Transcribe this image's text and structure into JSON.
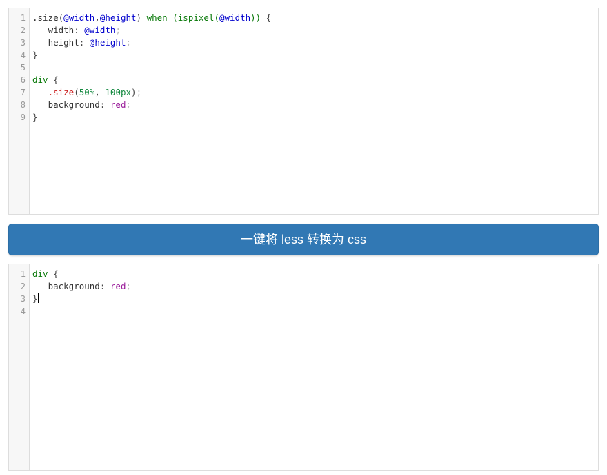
{
  "input_editor": {
    "name": "less-input-editor",
    "line_numbers": [
      "1",
      "2",
      "3",
      "4",
      "5",
      "6",
      "7",
      "8",
      "9"
    ],
    "lines": [
      {
        "n": "1",
        "tokens": [
          {
            "t": ".size",
            "c": "t-plain"
          },
          {
            "t": "(",
            "c": "t-punct"
          },
          {
            "t": "@width",
            "c": "t-var"
          },
          {
            "t": ",",
            "c": "t-punct"
          },
          {
            "t": "@height",
            "c": "t-var"
          },
          {
            "t": ")",
            "c": "t-punct"
          },
          {
            "t": " ",
            "c": "t-plain"
          },
          {
            "t": "when",
            "c": "t-kw"
          },
          {
            "t": " ",
            "c": "t-plain"
          },
          {
            "t": "(",
            "c": "t-paren"
          },
          {
            "t": "ispixel",
            "c": "t-kw"
          },
          {
            "t": "(",
            "c": "t-paren"
          },
          {
            "t": "@width",
            "c": "t-var"
          },
          {
            "t": "))",
            "c": "t-paren"
          },
          {
            "t": " {",
            "c": "t-punct"
          }
        ]
      },
      {
        "n": "2",
        "tokens": [
          {
            "t": "   width",
            "c": "t-plain"
          },
          {
            "t": ": ",
            "c": "t-punct"
          },
          {
            "t": "@width",
            "c": "t-var"
          },
          {
            "t": ";",
            "c": "t-semi"
          }
        ]
      },
      {
        "n": "3",
        "tokens": [
          {
            "t": "   height",
            "c": "t-plain"
          },
          {
            "t": ": ",
            "c": "t-punct"
          },
          {
            "t": "@height",
            "c": "t-var"
          },
          {
            "t": ";",
            "c": "t-semi"
          }
        ]
      },
      {
        "n": "4",
        "tokens": [
          {
            "t": "}",
            "c": "t-punct"
          }
        ]
      },
      {
        "n": "5",
        "tokens": []
      },
      {
        "n": "6",
        "tokens": [
          {
            "t": "div",
            "c": "t-tag"
          },
          {
            "t": " {",
            "c": "t-punct"
          }
        ]
      },
      {
        "n": "7",
        "tokens": [
          {
            "t": "   ",
            "c": "t-plain"
          },
          {
            "t": ".size",
            "c": "t-mixin"
          },
          {
            "t": "(",
            "c": "t-punct"
          },
          {
            "t": "50%",
            "c": "t-num"
          },
          {
            "t": ", ",
            "c": "t-punct"
          },
          {
            "t": "100px",
            "c": "t-num"
          },
          {
            "t": ")",
            "c": "t-punct"
          },
          {
            "t": ";",
            "c": "t-semi"
          }
        ]
      },
      {
        "n": "8",
        "tokens": [
          {
            "t": "   background",
            "c": "t-plain"
          },
          {
            "t": ": ",
            "c": "t-punct"
          },
          {
            "t": "red",
            "c": "t-value"
          },
          {
            "t": ";",
            "c": "t-semi"
          }
        ]
      },
      {
        "n": "9",
        "tokens": [
          {
            "t": "}",
            "c": "t-punct"
          }
        ]
      }
    ]
  },
  "convert_button": {
    "label": "一键将 less 转换为 css",
    "color": "#3178b4",
    "text_color": "#ffffff"
  },
  "output_editor": {
    "name": "css-output-editor",
    "line_numbers": [
      "1",
      "2",
      "3",
      "4"
    ],
    "lines": [
      {
        "n": "1",
        "tokens": [
          {
            "t": "div",
            "c": "t-tag"
          },
          {
            "t": " {",
            "c": "t-punct"
          }
        ]
      },
      {
        "n": "2",
        "tokens": [
          {
            "t": "   background",
            "c": "t-plain"
          },
          {
            "t": ": ",
            "c": "t-punct"
          },
          {
            "t": "red",
            "c": "t-value"
          },
          {
            "t": ";",
            "c": "t-semi"
          }
        ]
      },
      {
        "n": "3",
        "tokens": [
          {
            "t": "}",
            "c": "t-punct"
          }
        ],
        "caret": true
      },
      {
        "n": "4",
        "tokens": []
      }
    ]
  }
}
